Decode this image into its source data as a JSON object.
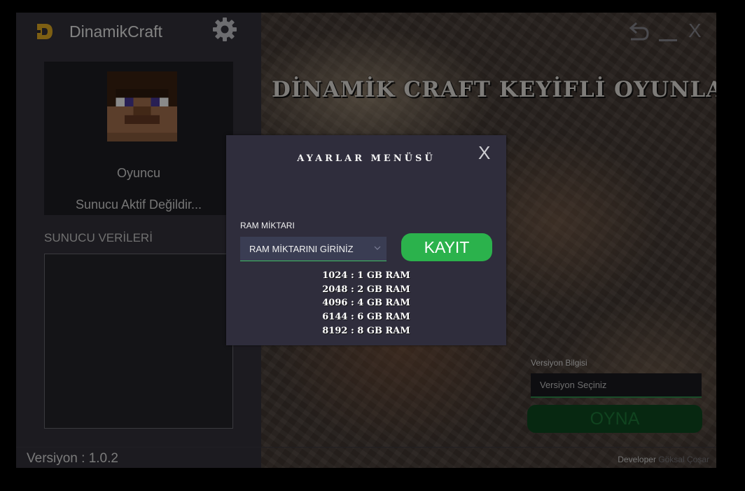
{
  "app": {
    "title": "DinamikCraft",
    "version": "Versiyon : 1.0.2"
  },
  "window": {
    "back_icon": "undo-arrow-icon",
    "minimize_icon": "minimize-icon",
    "close_label": "X"
  },
  "sidebar": {
    "player_name": "Oyuncu",
    "server_status": "Sunucu Aktif Değildir...",
    "server_data_title": "SUNUCU VERİLERİ"
  },
  "hero": {
    "title": "DİNAMİK CRAFT KEYİFLİ OYUNLAR DİLER"
  },
  "launcher": {
    "version_info_label": "Versiyon Bilgisi",
    "version_select_placeholder": "Versiyon Seçiniz",
    "play_label": "OYNA",
    "developer_prefix": "Developer",
    "developer_name": "Göksal Çoşar"
  },
  "settings_modal": {
    "title": "AYARLAR MENÜSÜ",
    "close_label": "X",
    "ram_label": "RAM MİKTARI",
    "ram_input_placeholder": "RAM MİKTARINI GİRİNİZ",
    "save_label": "KAYIT",
    "ram_hints": [
      "1024 : 1 GB RAM",
      "2048 : 2 GB RAM",
      "4096 : 4 GB RAM",
      "6144 : 6 GB RAM",
      "8192 : 8 GB RAM"
    ]
  },
  "colors": {
    "accent_green": "#2bb24c",
    "play_green_dim": "#0d4a20",
    "modal_bg": "#2f2d3c",
    "logo_gold": "#e8b024"
  }
}
